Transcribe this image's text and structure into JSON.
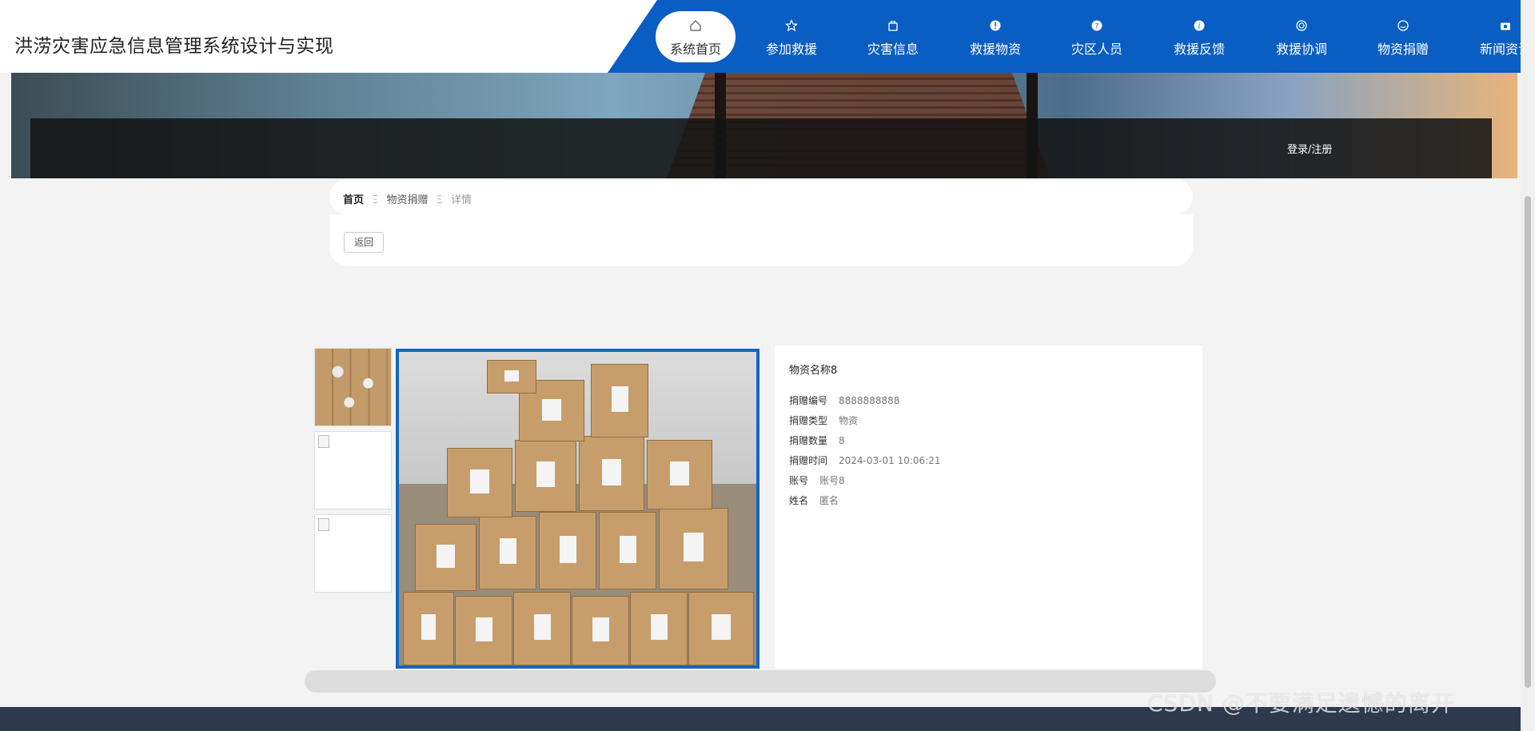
{
  "header": {
    "site_title": "洪涝灾害应急信息管理系统设计与实现",
    "nav": [
      {
        "label": "系统首页",
        "icon": "home-icon"
      },
      {
        "label": "参加救援",
        "icon": "star-icon"
      },
      {
        "label": "灾害信息",
        "icon": "bag-icon"
      },
      {
        "label": "救援物资",
        "icon": "alert-icon"
      },
      {
        "label": "灾区人员",
        "icon": "question-icon"
      },
      {
        "label": "救援反馈",
        "icon": "info-icon"
      },
      {
        "label": "救援协调",
        "icon": "globe-icon"
      },
      {
        "label": "物资捐赠",
        "icon": "smile-icon"
      },
      {
        "label": "新闻资讯",
        "icon": "camera-icon"
      }
    ],
    "accent_color": "#0a5dc2"
  },
  "banner": {
    "login_label": "登录/注册"
  },
  "breadcrumb": {
    "home": "首页",
    "section": "物资捐赠",
    "current": "详情",
    "separator": "Ξ"
  },
  "back_button": "返回",
  "detail": {
    "name": "物资名称8",
    "fields": [
      {
        "key": "捐赠编号",
        "value": "8888888888"
      },
      {
        "key": "捐赠类型",
        "value": "物资"
      },
      {
        "key": "捐赠数量",
        "value": "8"
      },
      {
        "key": "捐赠时间",
        "value": "2024-03-01 10:06:21"
      },
      {
        "key": "账号",
        "value": "账号8"
      },
      {
        "key": "姓名",
        "value": "匿名"
      }
    ]
  },
  "watermark": "CSDN @不要满足遗憾的离开"
}
